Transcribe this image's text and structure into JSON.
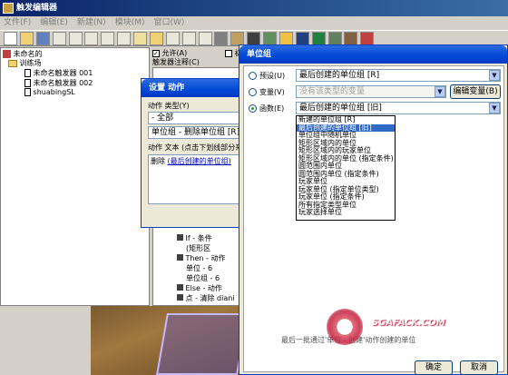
{
  "app": {
    "title": "触发编辑器"
  },
  "menu": [
    "文件(F)",
    "编辑(E)",
    "新建(N)",
    "模块(M)",
    "窗口(W)"
  ],
  "tree": {
    "root": "未命名的",
    "category": "训练场",
    "items": [
      "未命名触发器 001",
      "未命名触发器 002",
      "shuabingSL"
    ]
  },
  "trigger_panel": {
    "enabled_label": "允许(A)",
    "initial_label": "初始",
    "comment_label": "触发器注释(C)"
  },
  "action_tree": [
    "If - 条件",
    "(矩形区",
    "Then - 动作",
    "单位 - 6",
    "单位组 - 6",
    "Else - 动作",
    "点 - 清除 diani"
  ],
  "action_dialog": {
    "title": "设置 动作",
    "type_label": "动作 类型(Y)",
    "type_value": "- 全部",
    "action_value": "单位组 - 删除单位组 [R]",
    "text_label": "动作 文本 (点击下划线部分来",
    "text_prefix": "删除",
    "text_link": "(最后创建的单位组)"
  },
  "unitgroup_dialog": {
    "title": "单位组",
    "preset_label": "预设(U)",
    "preset_value": "最后创建的单位组 [R]",
    "variable_label": "变量(V)",
    "variable_value": "没有该类型的变量",
    "edit_variable_button": "编辑变量(B)",
    "function_label": "函数(E)",
    "function_value": "最后创建的单位组 [旧]",
    "description": "最后一批通过'单位 - 创建'动作创建的单位",
    "ok_button": "确定",
    "cancel_button": "取消"
  },
  "function_list": [
    "新建的单位组 [R]",
    "最后创建的单位组 [旧]",
    "单位组中随机单位",
    "矩形区域内的单位",
    "矩形区域内的玩家单位",
    "矩形区域内的单位 (指定条件)",
    "圆范围内单位",
    "圆范围内单位 (指定条件)",
    "玩家单位",
    "玩家单位 (指定单位类型)",
    "玩家单位 (指定条件)",
    "所有指定类型单位",
    "玩家选择单位"
  ],
  "function_list_selected": 1,
  "watermark": {
    "url": "SGAFACK.COM"
  }
}
